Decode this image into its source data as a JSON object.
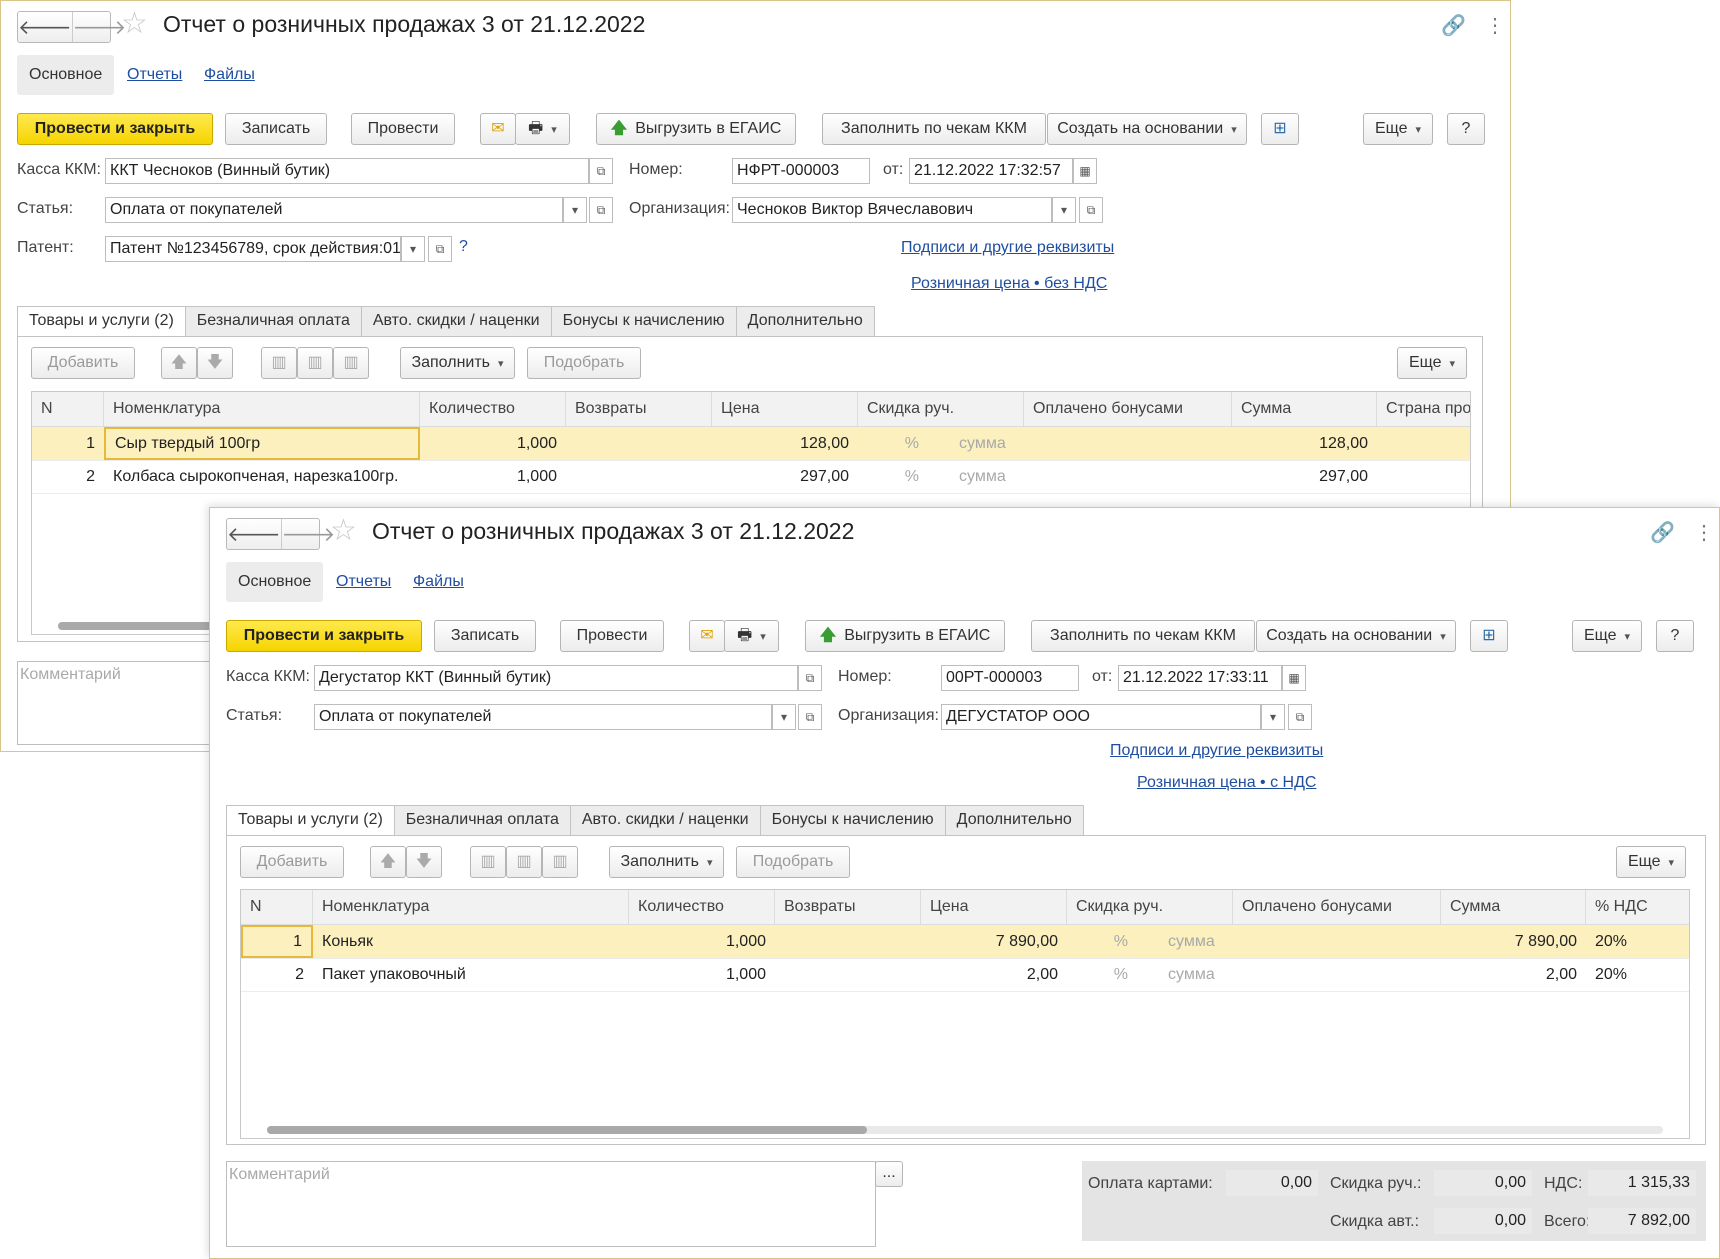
{
  "back_window": {
    "title": "Отчет о розничных продажах 3 от 21.12.2022",
    "sections": [
      "Основное",
      "Отчеты",
      "Файлы"
    ],
    "toolbar": {
      "post_close": "Провести и закрыть",
      "save": "Записать",
      "post": "Провести",
      "upload_egais": "Выгрузить в ЕГАИС",
      "fill_kkm": "Заполнить по чекам ККМ",
      "create_based": "Создать на основании",
      "more": "Еще",
      "help": "?"
    },
    "fields": {
      "kassa_label": "Касса ККМ:",
      "kassa_value": "ККТ Чесноков (Винный бутик)",
      "number_label": "Номер:",
      "number_value": "НФРТ-000003",
      "date_label": "от:",
      "date_value": "21.12.2022 17:32:57",
      "article_label": "Статья:",
      "article_value": "Оплата от покупателей",
      "org_label": "Организация:",
      "org_value": "Чесноков Виктор Вячеславович",
      "patent_label": "Патент:",
      "patent_value": "Патент №123456789, срок действия:01.",
      "help_mark": "?"
    },
    "links": {
      "signatures": "Подписи и другие реквизиты",
      "price": "Розничная цена • без НДС"
    },
    "tabs": [
      "Товары и услуги (2)",
      "Безналичная оплата",
      "Авто. скидки / наценки",
      "Бонусы к начислению",
      "Дополнительно"
    ],
    "table_toolbar": {
      "add": "Добавить",
      "fill": "Заполнить",
      "select": "Подобрать",
      "more": "Еще"
    },
    "columns": [
      "N",
      "Номенклатура",
      "Количество",
      "Возвраты",
      "Цена",
      "Скидка руч.",
      "Оплачено бонусами",
      "Сумма",
      "Страна про"
    ],
    "rows": [
      {
        "n": "1",
        "name": "Сыр твердый 100гр",
        "qty": "1,000",
        "returns": "",
        "price": "128,00",
        "pct": "%",
        "disc": "сумма",
        "bonus": "",
        "sum": "128,00",
        "extra": ""
      },
      {
        "n": "2",
        "name": "Колбаса сырокопченая, нарезка100гр.",
        "qty": "1,000",
        "returns": "",
        "price": "297,00",
        "pct": "%",
        "disc": "сумма",
        "bonus": "",
        "sum": "297,00",
        "extra": ""
      }
    ],
    "comment_placeholder": "Комментарий"
  },
  "front_window": {
    "title": "Отчет о розничных продажах 3 от 21.12.2022",
    "sections": [
      "Основное",
      "Отчеты",
      "Файлы"
    ],
    "toolbar": {
      "post_close": "Провести и закрыть",
      "save": "Записать",
      "post": "Провести",
      "upload_egais": "Выгрузить в ЕГАИС",
      "fill_kkm": "Заполнить по чекам ККМ",
      "create_based": "Создать на основании",
      "more": "Еще",
      "help": "?"
    },
    "fields": {
      "kassa_label": "Касса ККМ:",
      "kassa_value": "Дегустатор ККТ (Винный бутик)",
      "number_label": "Номер:",
      "number_value": "00РТ-000003",
      "date_label": "от:",
      "date_value": "21.12.2022 17:33:11",
      "article_label": "Статья:",
      "article_value": "Оплата от покупателей",
      "org_label": "Организация:",
      "org_value": "ДЕГУСТАТОР ООО"
    },
    "links": {
      "signatures": "Подписи и другие реквизиты",
      "price": "Розничная цена • с НДС"
    },
    "tabs": [
      "Товары и услуги (2)",
      "Безналичная оплата",
      "Авто. скидки / наценки",
      "Бонусы к начислению",
      "Дополнительно"
    ],
    "table_toolbar": {
      "add": "Добавить",
      "fill": "Заполнить",
      "select": "Подобрать",
      "more": "Еще"
    },
    "columns": [
      "N",
      "Номенклатура",
      "Количество",
      "Возвраты",
      "Цена",
      "Скидка руч.",
      "Оплачено бонусами",
      "Сумма",
      "% НДС"
    ],
    "rows": [
      {
        "n": "1",
        "name": "Коньяк",
        "qty": "1,000",
        "returns": "",
        "price": "7 890,00",
        "pct": "%",
        "disc": "сумма",
        "bonus": "",
        "sum": "7 890,00",
        "vat": "20%"
      },
      {
        "n": "2",
        "name": "Пакет упаковочный",
        "qty": "1,000",
        "returns": "",
        "price": "2,00",
        "pct": "%",
        "disc": "сумма",
        "bonus": "",
        "sum": "2,00",
        "vat": "20%"
      }
    ],
    "comment_placeholder": "Комментарий",
    "comment_btn": "...",
    "totals": {
      "card_label": "Оплата картами:",
      "card_value": "0,00",
      "manual_label": "Скидка руч.:",
      "manual_value": "0,00",
      "vat_label": "НДС:",
      "vat_value": "1 315,33",
      "auto_label": "Скидка авт.:",
      "auto_value": "0,00",
      "total_label": "Всего:",
      "total_value": "7 892,00"
    }
  },
  "colors": {
    "primary": "#f6d400",
    "link": "#1f4ea1",
    "selected_row": "#fbf0be"
  },
  "icons": [
    "back-arrow-icon",
    "forward-arrow-icon",
    "star-icon",
    "link-icon",
    "more-vert-icon",
    "close-icon",
    "mail-icon",
    "print-icon",
    "structure-icon",
    "upload-icon",
    "calendar-icon",
    "open-icon",
    "dropdown-icon",
    "move-up-icon",
    "move-down-icon",
    "barcode-icon"
  ]
}
